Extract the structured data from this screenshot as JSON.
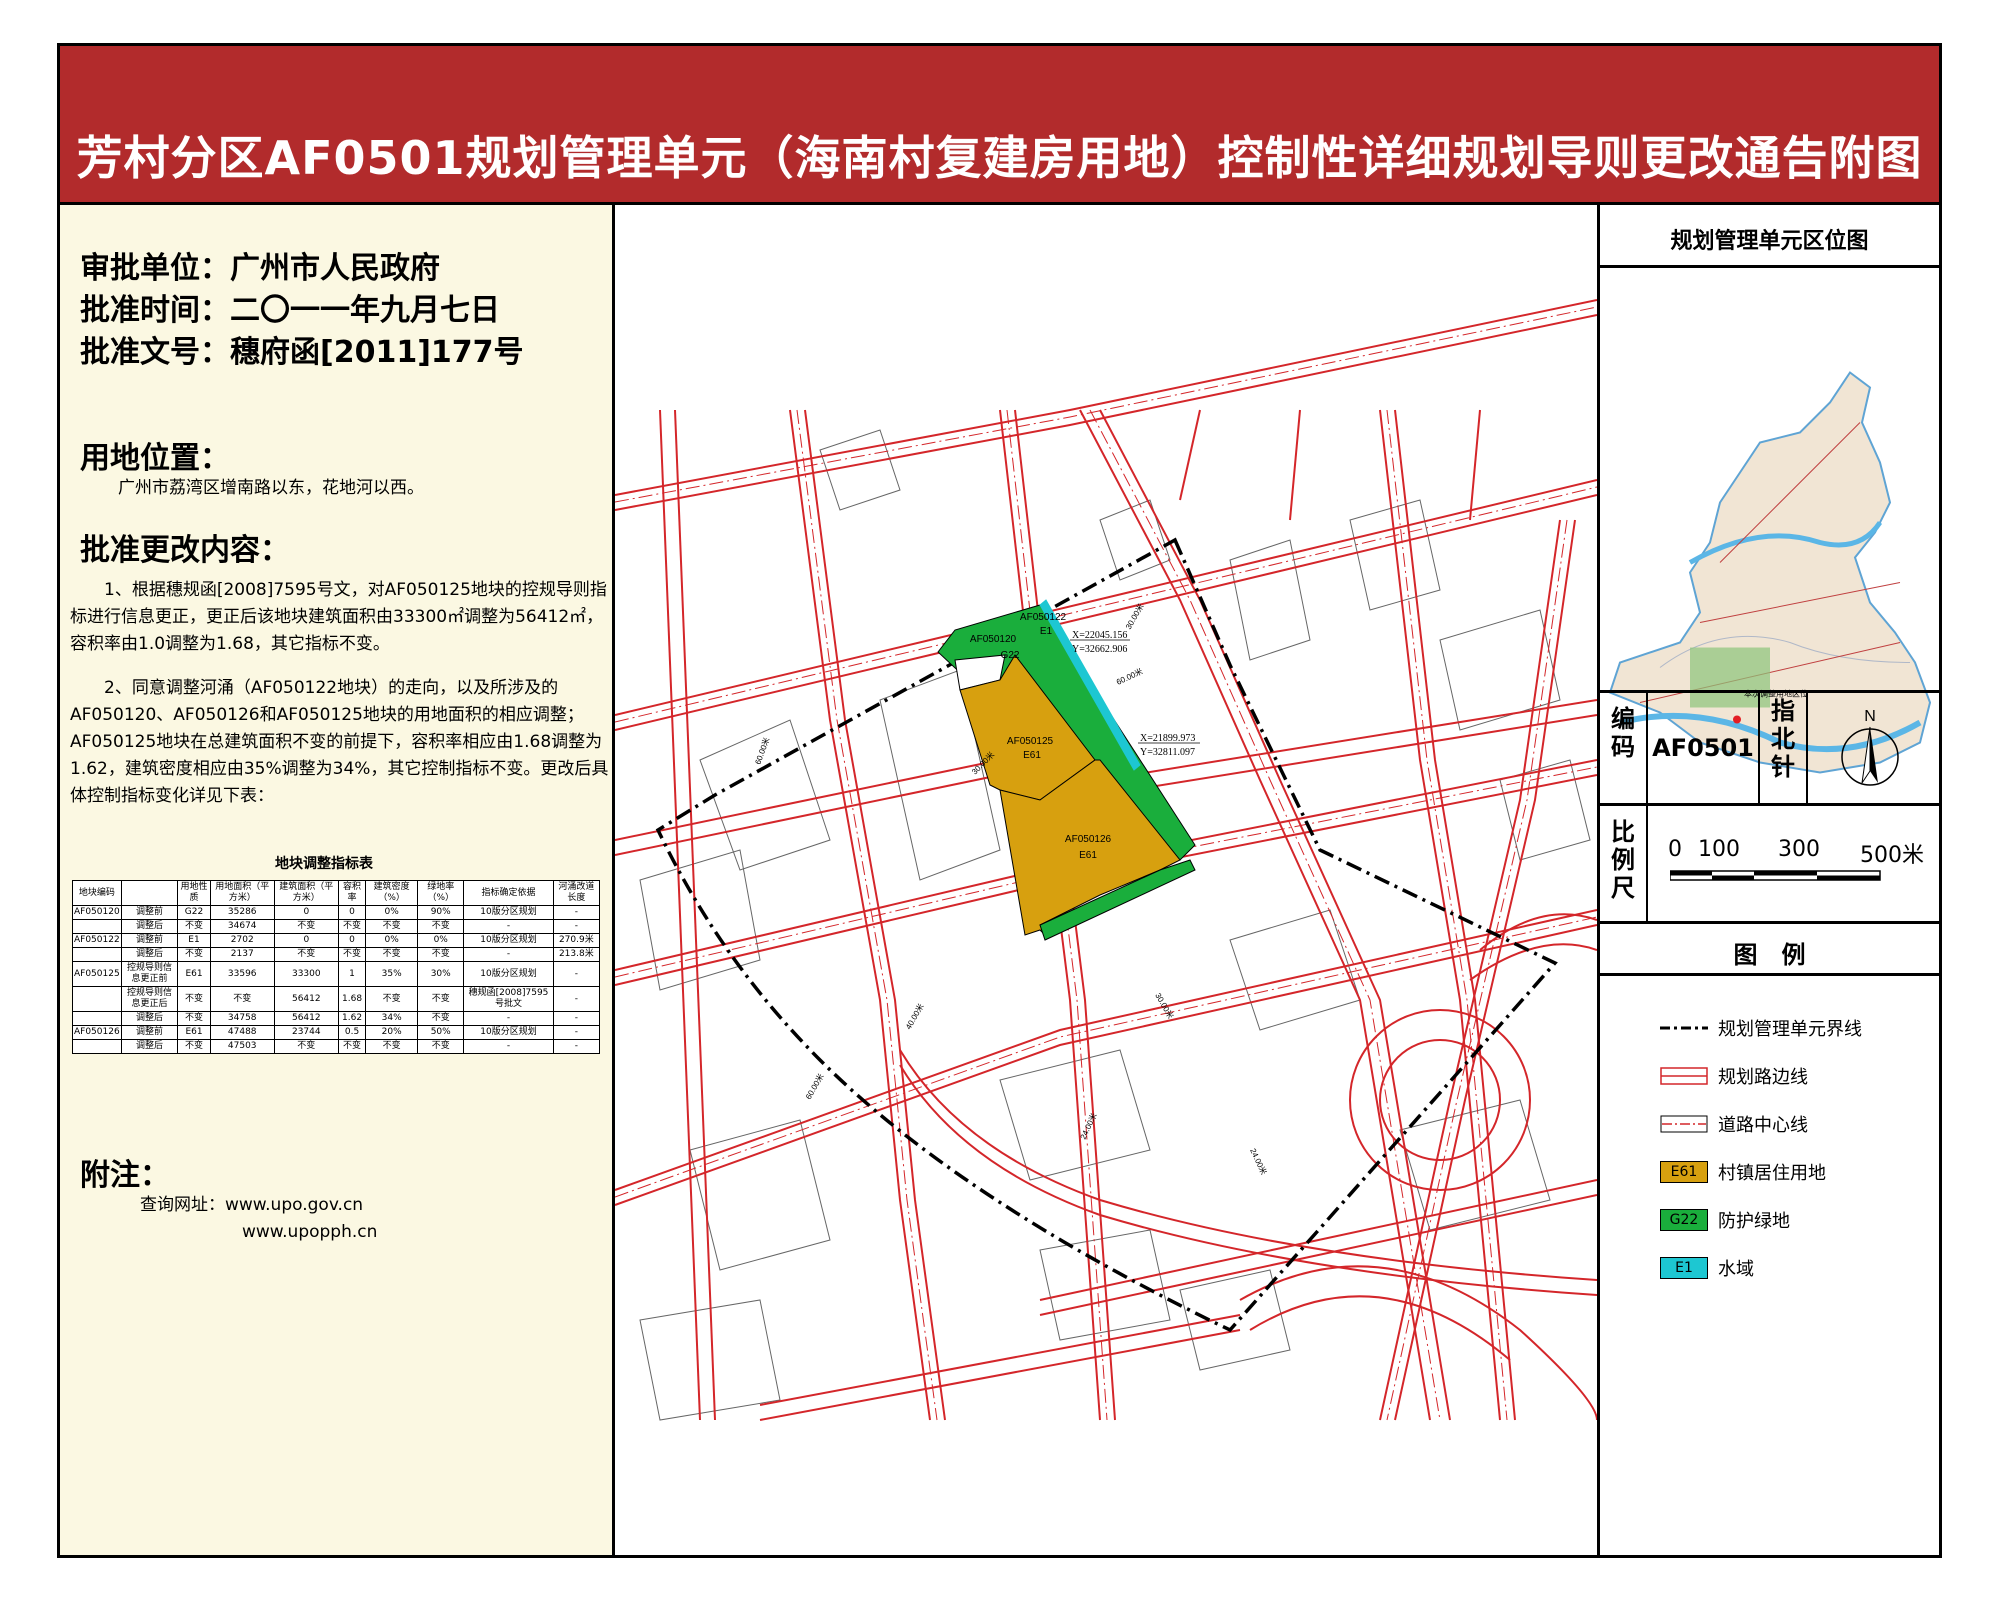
{
  "title": "芳村分区AF0501规划管理单元（海南村复建房用地）控制性详细规划导则更改通告附图",
  "approval": {
    "unit_label": "审批单位：",
    "unit_value": "广州市人民政府",
    "time_label": "批准时间：",
    "time_value": "二〇一一年九月七日",
    "doc_label": "批准文号：",
    "doc_value": "穗府函[2011]177号"
  },
  "location": {
    "heading": "用地位置：",
    "text": "广州市荔湾区增南路以东，花地河以西。"
  },
  "changes": {
    "heading": "批准更改内容：",
    "para1": "1、根据穗规函[2008]7595号文，对AF050125地块的控规导则指标进行信息更正，更正后该地块建筑面积由33300㎡调整为56412㎡，容积率由1.0调整为1.68，其它指标不变。",
    "para2": "2、同意调整河涌（AF050122地块）的走向，以及所涉及的AF050120、AF050126和AF050125地块的用地面积的相应调整；AF050125地块在总建筑面积不变的前提下，容积率相应由1.68调整为1.62，建筑密度相应由35%调整为34%，其它控制指标不变。更改后具体控制指标变化详见下表："
  },
  "table": {
    "title": "地块调整指标表",
    "headers": [
      "地块编码",
      "",
      "用地性质",
      "用地面积（平方米）",
      "建筑面积（平方米）",
      "容积率",
      "建筑密度（%）",
      "绿地率（%）",
      "指标确定依据",
      "河涌改道长度"
    ],
    "rows": [
      [
        "AF050120",
        "调整前",
        "G22",
        "35286",
        "0",
        "0",
        "0%",
        "90%",
        "10版分区规划",
        "-"
      ],
      [
        "",
        "调整后",
        "不变",
        "34674",
        "不变",
        "不变",
        "不变",
        "不变",
        "-",
        "-"
      ],
      [
        "AF050122",
        "调整前",
        "E1",
        "2702",
        "0",
        "0",
        "0%",
        "0%",
        "10版分区规划",
        "270.9米"
      ],
      [
        "",
        "调整后",
        "不变",
        "2137",
        "不变",
        "不变",
        "不变",
        "不变",
        "-",
        "213.8米"
      ],
      [
        "AF050125",
        "控规导则信息更正前",
        "E61",
        "33596",
        "33300",
        "1",
        "35%",
        "30%",
        "10版分区规划",
        "-"
      ],
      [
        "",
        "控规导则信息更正后",
        "不变",
        "不变",
        "56412",
        "1.68",
        "不变",
        "不变",
        "穗规函[2008]7595号批文",
        "-"
      ],
      [
        "",
        "调整后",
        "不变",
        "34758",
        "56412",
        "1.62",
        "34%",
        "不变",
        "-",
        "-"
      ],
      [
        "AF050126",
        "调整前",
        "E61",
        "47488",
        "23744",
        "0.5",
        "20%",
        "50%",
        "10版分区规划",
        "-"
      ],
      [
        "",
        "调整后",
        "不变",
        "47503",
        "不变",
        "不变",
        "不变",
        "不变",
        "-",
        "-"
      ]
    ]
  },
  "notes": {
    "heading": "附注：",
    "url_label": "查询网址：",
    "url1": "www.upo.gov.cn",
    "url2": "www.upopph.cn"
  },
  "map": {
    "parcels": [
      {
        "id": "AF050120",
        "use": "G22",
        "color": "#1aae3c"
      },
      {
        "id": "AF050122",
        "use": "E1",
        "color": "#1dc7d2"
      },
      {
        "id": "AF050125",
        "use": "E61",
        "color": "#d7a00f"
      },
      {
        "id": "AF050126",
        "use": "E61",
        "color": "#d7a00f"
      }
    ],
    "coord1_x": "X=22045.156",
    "coord1_y": "Y=32662.906",
    "coord2_x": "X=21899.973",
    "coord2_y": "Y=32811.097",
    "road_label_1": "60.00米",
    "road_label_2": "60.00米",
    "road_label_3": "30.00米",
    "road_label_4": "30.00米",
    "road_label_5": "40.00米",
    "road_label_6": "60.00米",
    "road_label_7": "30.00米",
    "road_label_8": "24.00米",
    "road_label_9": "24.00米"
  },
  "locator": {
    "title": "规划管理单元区位图",
    "label": "本次调整用地区位"
  },
  "info": {
    "code_label": "编码",
    "code_value": "AF0501",
    "north_label": "指北针",
    "north_letter": "N",
    "scale_label": "比例尺",
    "scale_ticks": [
      "0",
      "100",
      "300",
      "500米"
    ]
  },
  "legend": {
    "title": "图　例",
    "items": [
      {
        "name": "规划管理单元界线",
        "sym": ""
      },
      {
        "name": "规划路边线",
        "sym": ""
      },
      {
        "name": "道路中心线",
        "sym": ""
      },
      {
        "name": "村镇居住用地",
        "sym": "E61",
        "color": "#d7a00f"
      },
      {
        "name": "防护绿地",
        "sym": "G22",
        "color": "#1aae3c"
      },
      {
        "name": "水域",
        "sym": "E1",
        "color": "#1dc7d2"
      }
    ]
  }
}
